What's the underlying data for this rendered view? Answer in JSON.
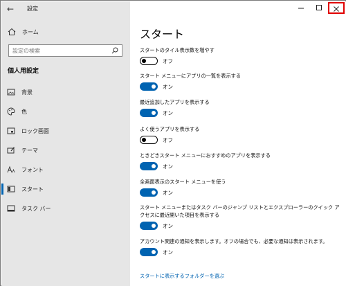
{
  "window": {
    "title": "設定"
  },
  "sidebar": {
    "home_label": "ホーム",
    "search_placeholder": "設定の検索",
    "section_title": "個人用設定",
    "items": [
      {
        "label": "背景",
        "icon": "picture-icon"
      },
      {
        "label": "色",
        "icon": "palette-icon"
      },
      {
        "label": "ロック画面",
        "icon": "lock-screen-icon"
      },
      {
        "label": "テーマ",
        "icon": "theme-icon"
      },
      {
        "label": "フォント",
        "icon": "font-icon"
      },
      {
        "label": "スタート",
        "icon": "start-icon",
        "active": true
      },
      {
        "label": "タスク バー",
        "icon": "taskbar-icon"
      }
    ]
  },
  "main": {
    "title": "スタート",
    "settings": [
      {
        "label": "スタートのタイル表示数を増やす",
        "state": "オフ",
        "on": false
      },
      {
        "label": "スタート メニューにアプリの一覧を表示する",
        "state": "オン",
        "on": true
      },
      {
        "label": "最近追加したアプリを表示する",
        "state": "オン",
        "on": true
      },
      {
        "label": "よく使うアプリを表示する",
        "state": "オフ",
        "on": false
      },
      {
        "label": "ときどきスタート メニューにおすすめのアプリを表示する",
        "state": "オン",
        "on": true
      },
      {
        "label": "全画面表示のスタート メニューを使う",
        "state": "オン",
        "on": true
      },
      {
        "label": "スタート メニューまたはタスク バーのジャンプ リストとエクスプローラーのクイック アクセスに最近開いた項目を表示する",
        "state": "オン",
        "on": true
      },
      {
        "label": "アカウント関連の通知を表示します。オフの場合でも、必要な通知は表示されます。",
        "state": "オン",
        "on": true
      }
    ],
    "link": "スタートに表示するフォルダーを選ぶ"
  },
  "colors": {
    "accent": "#0063b1",
    "sidebar_bg": "#e6e6e6",
    "highlight": "#e00000"
  }
}
